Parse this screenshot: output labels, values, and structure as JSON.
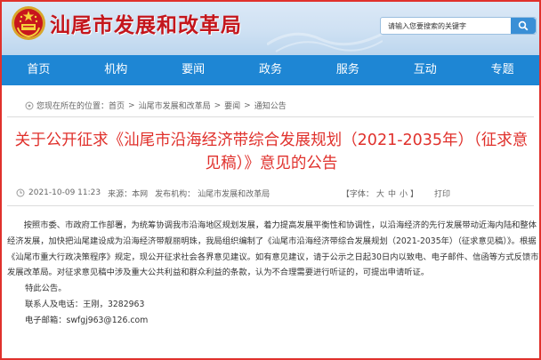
{
  "site": {
    "title": "汕尾市发展和改革局"
  },
  "search": {
    "placeholder": "请输入您要搜索的关键字"
  },
  "nav": {
    "items": [
      "首页",
      "机构",
      "要闻",
      "政务",
      "服务",
      "互动",
      "专题"
    ]
  },
  "breadcrumb": {
    "prefix": "您现在所在的位置：",
    "items": [
      "首页",
      "汕尾市发展和改革局",
      "要闻",
      "通知公告"
    ]
  },
  "article": {
    "title": "关于公开征求《汕尾市沿海经济带综合发展规划（2021-2035年）（征求意见稿）》意见的公告",
    "date": "2021-10-09 11:23",
    "source_label": "来源：本网",
    "publisher_label": "发布机构：",
    "publisher": "汕尾市发展和改革局",
    "font_size": {
      "label": "【字体：",
      "large": "大",
      "medium": "中",
      "small": "小",
      "close": "】"
    },
    "print_label": "打印",
    "paragraphs": [
      "按照市委、市政府工作部署，为统筹协调我市沿海地区规划发展，着力提高发展平衡性和协调性，以沿海经济的先行发展带动近海内陆和整体经济发展，加快把汕尾建设成为沿海经济带靓丽明珠，我局组织编制了《汕尾市沿海经济带综合发展规划（2021-2035年）（征求意见稿）》。根据《汕尾市重大行政决策程序》规定，现公开征求社会各界意见建议。如有意见建议，请于公示之日起30日内以致电、电子邮件、信函等方式反馈市发展改革局。对征求意见稿中涉及重大公共利益和群众利益的条款，认为不合理需要进行听证的，可提出申请听证。"
    ],
    "closing": "特此公告。",
    "contact": "联系人及电话：王刚，3282963",
    "email": "电子邮箱：swfgj963@126.com"
  }
}
